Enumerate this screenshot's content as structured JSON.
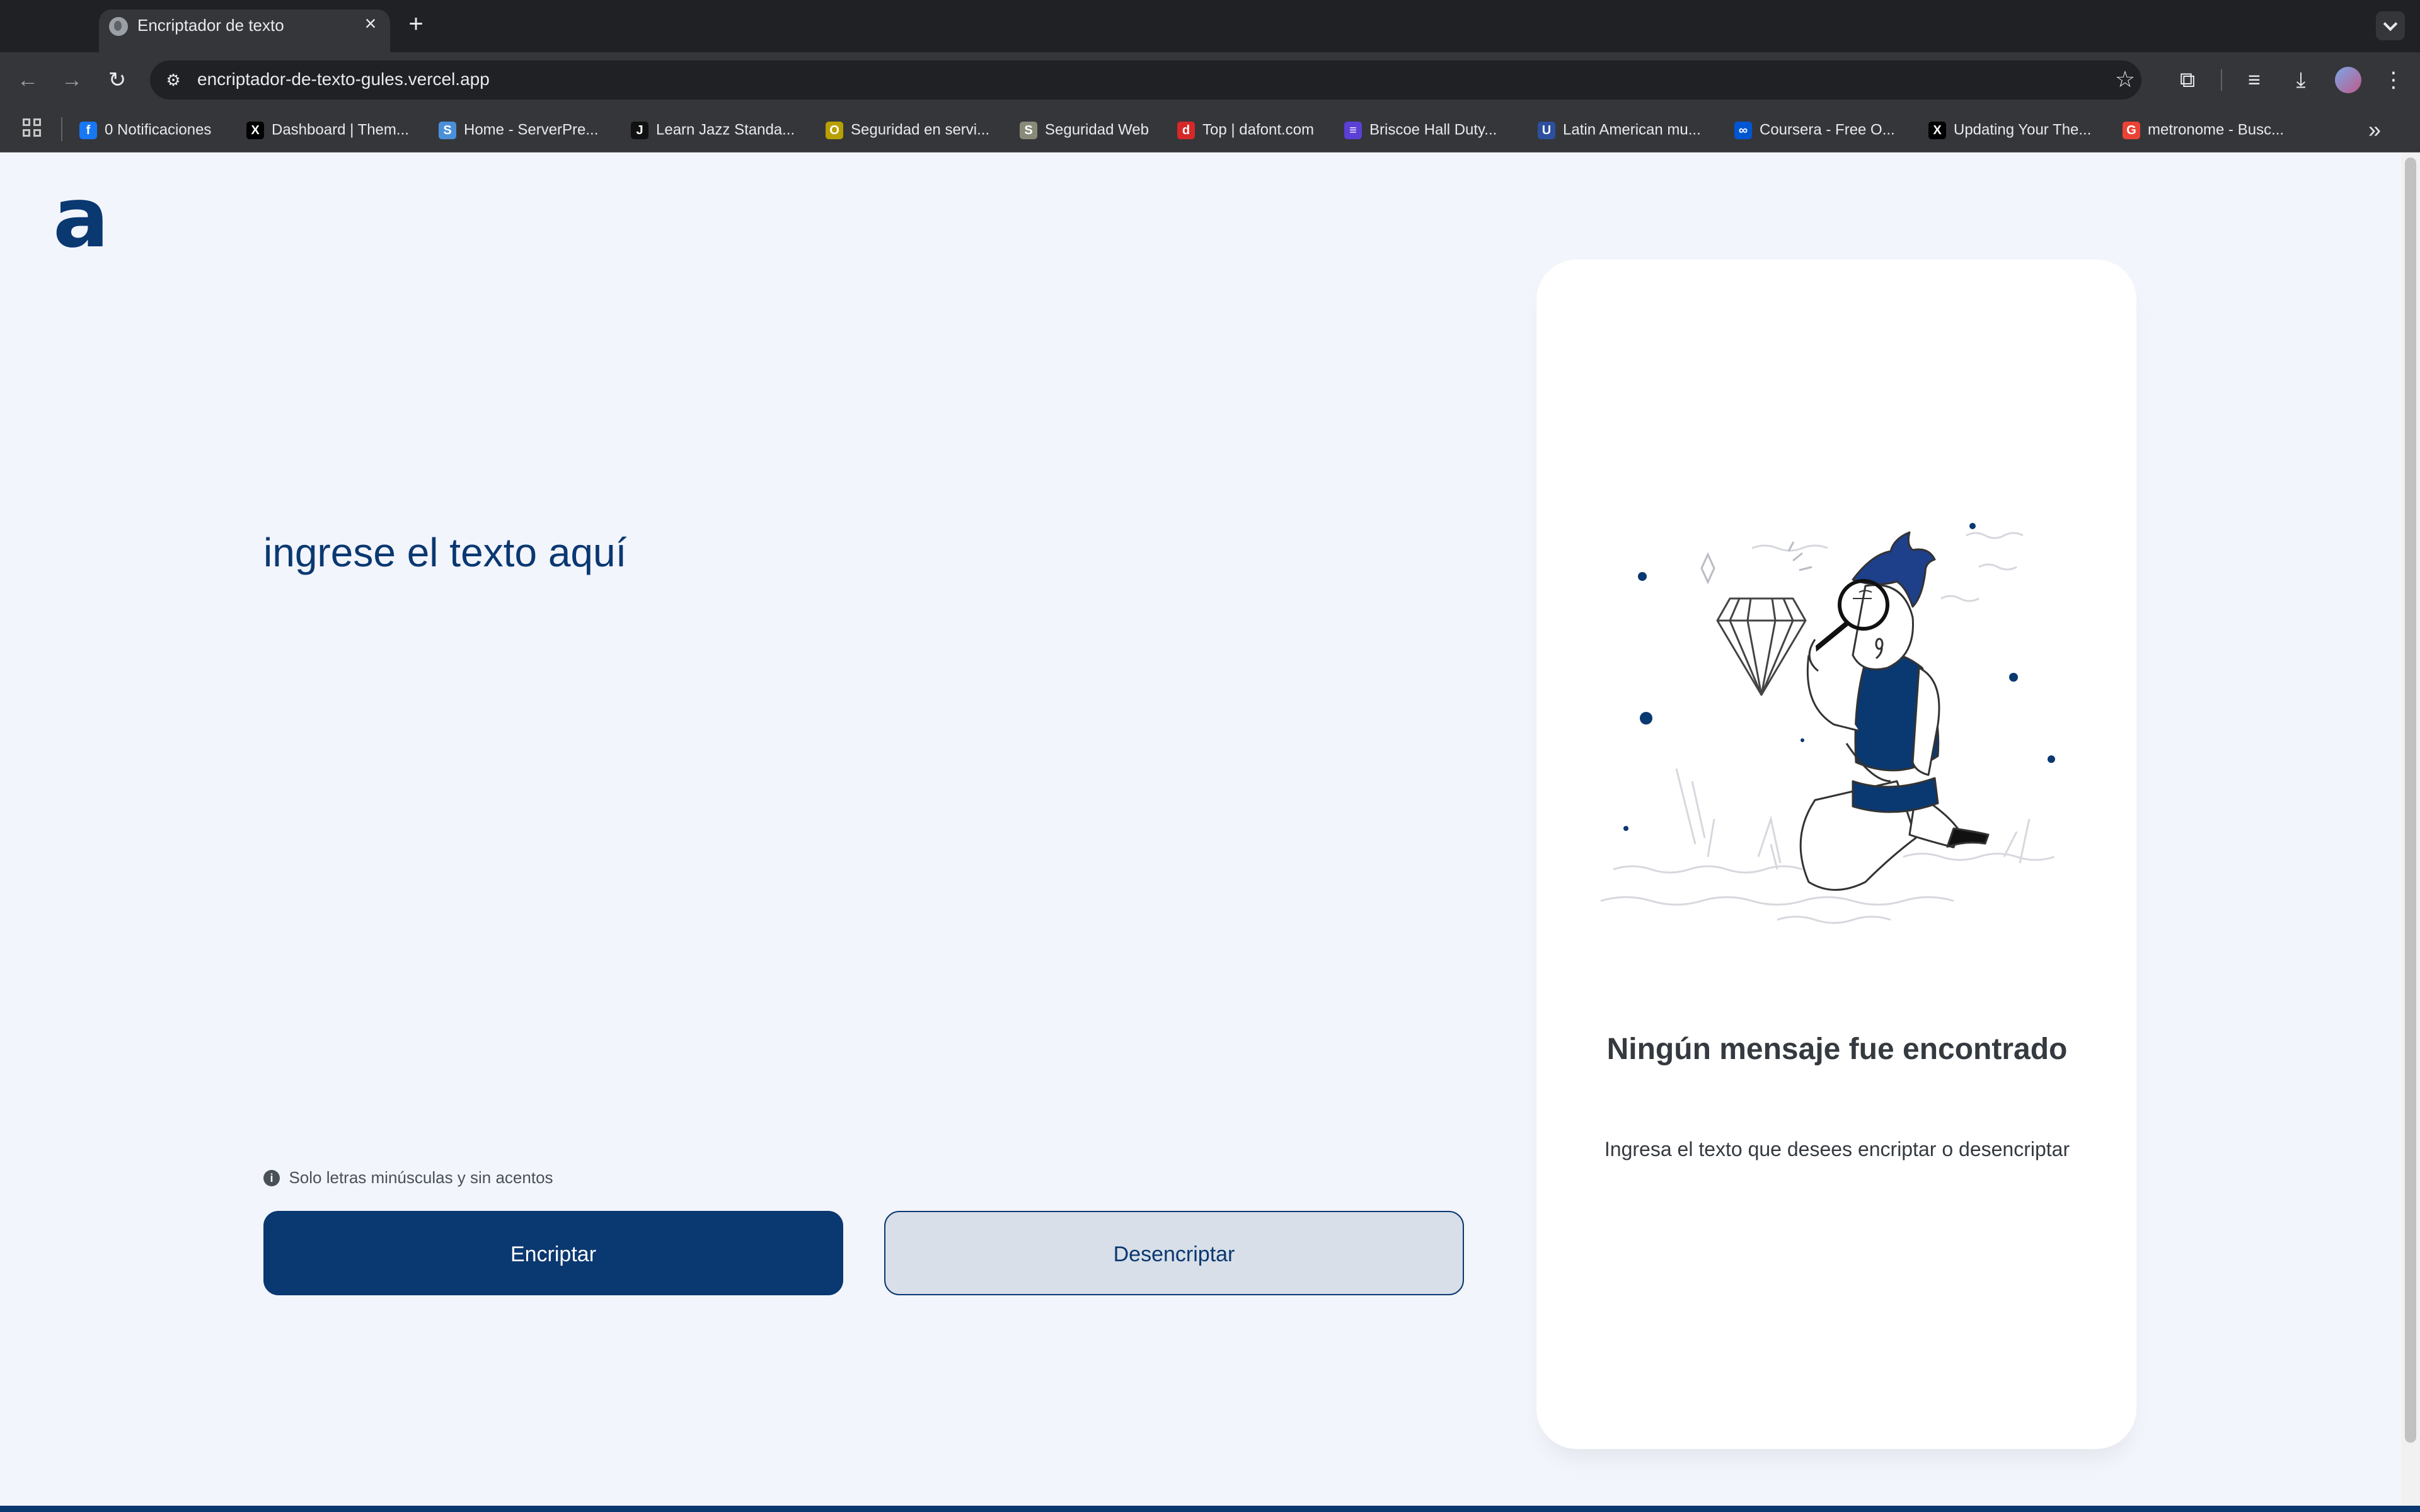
{
  "browser": {
    "tab_title": "Encriptador de texto",
    "url": "encriptador-de-texto-gules.vercel.app",
    "bookmarks": [
      {
        "label": "0 Notificaciones",
        "icon": "facebook-icon",
        "glyph": "f",
        "color": "#1877f2"
      },
      {
        "label": "Dashboard | Them...",
        "icon": "x-icon",
        "glyph": "X",
        "color": "#000000"
      },
      {
        "label": "Home - ServerPre...",
        "icon": "serverpress-icon",
        "glyph": "S",
        "color": "#4a90d9"
      },
      {
        "label": "Learn Jazz Standa...",
        "icon": "jazz-icon",
        "glyph": "J",
        "color": "#111111"
      },
      {
        "label": "Seguridad en servi...",
        "icon": "security-ring-icon",
        "glyph": "O",
        "color": "#b8a000"
      },
      {
        "label": "Seguridad Web",
        "icon": "web-security-icon",
        "glyph": "S",
        "color": "#8a8a7a"
      },
      {
        "label": "Top | dafont.com",
        "icon": "dafont-icon",
        "glyph": "d",
        "color": "#d62828"
      },
      {
        "label": "Briscoe Hall Duty...",
        "icon": "list-icon",
        "glyph": "≡",
        "color": "#5b3fd6"
      },
      {
        "label": "Latin American mu...",
        "icon": "shield-crest-icon",
        "glyph": "U",
        "color": "#2c4f9e"
      },
      {
        "label": "Coursera - Free O...",
        "icon": "coursera-icon",
        "glyph": "∞",
        "color": "#0056d2"
      },
      {
        "label": "Updating Your The...",
        "icon": "x-icon",
        "glyph": "X",
        "color": "#000000"
      },
      {
        "label": "metronome - Busc...",
        "icon": "google-icon",
        "glyph": "G",
        "color": "#ea4335"
      }
    ]
  },
  "app": {
    "logo": "a",
    "input_placeholder": "ingrese el texto aquí",
    "hint_icon": "i",
    "hint": "Solo letras minúsculas y sin acentos",
    "encrypt_label": "Encriptar",
    "decrypt_label": "Desencriptar",
    "output_title": "Ningún mensaje fue encontrado",
    "output_subtitle": "Ingresa el texto que desees encriptar o desencriptar"
  },
  "colors": {
    "primary": "#0a3871",
    "page_background": "#f3f5fc",
    "secondary_button": "#d8dfe8",
    "text_dark": "#343a40"
  }
}
